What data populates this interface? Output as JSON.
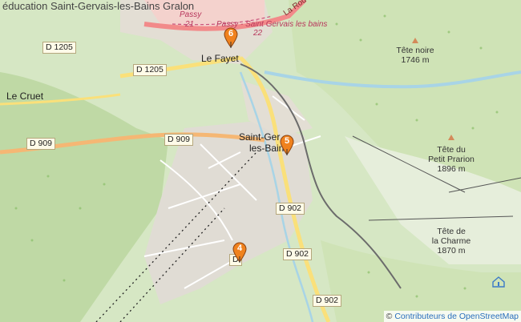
{
  "title": "éducation Saint-Gervais-les-Bains Gralon",
  "places": {
    "le_fayet": "Le Fayet",
    "le_cruet": "Le Cruet",
    "saint_gervais_line1": "Saint-Ger",
    "saint_gervais_line2": "les-Bain"
  },
  "roads": {
    "d1205_a": "D 1205",
    "d1205_b": "D 1205",
    "d909_a": "D 909",
    "d909_b": "D 909",
    "d902_a": "D 902",
    "d902_b": "D 902",
    "d902_c": "D 902",
    "d_partial": "D",
    "la_route": "La Rou"
  },
  "railway": {
    "passy_21_name": "Passy",
    "passy_21_num": "21",
    "passy_sg_name": "Passy - Saint Gervais les bains",
    "passy_sg_num": "22"
  },
  "peaks": {
    "tete_noire_name": "Tête noire",
    "tete_noire_alt": "1746 m",
    "tete_prarion_name_1": "Tête du",
    "tete_prarion_name_2": "Petit Prarion",
    "tete_prarion_alt": "1896 m",
    "tete_charme_name_1": "Tête de",
    "tete_charme_name_2": "la Charme",
    "tete_charme_alt": "1870 m"
  },
  "markers": [
    {
      "number": "6",
      "color": "#f0821e"
    },
    {
      "number": "5",
      "color": "#f0821e"
    },
    {
      "number": "4",
      "color": "#f0821e"
    }
  ],
  "attribution": {
    "symbol": "©",
    "link_text": "Contributeurs de OpenStreetMap"
  },
  "icons": [
    "peak-icon",
    "map-marker-icon",
    "tourist-info-icon"
  ]
}
